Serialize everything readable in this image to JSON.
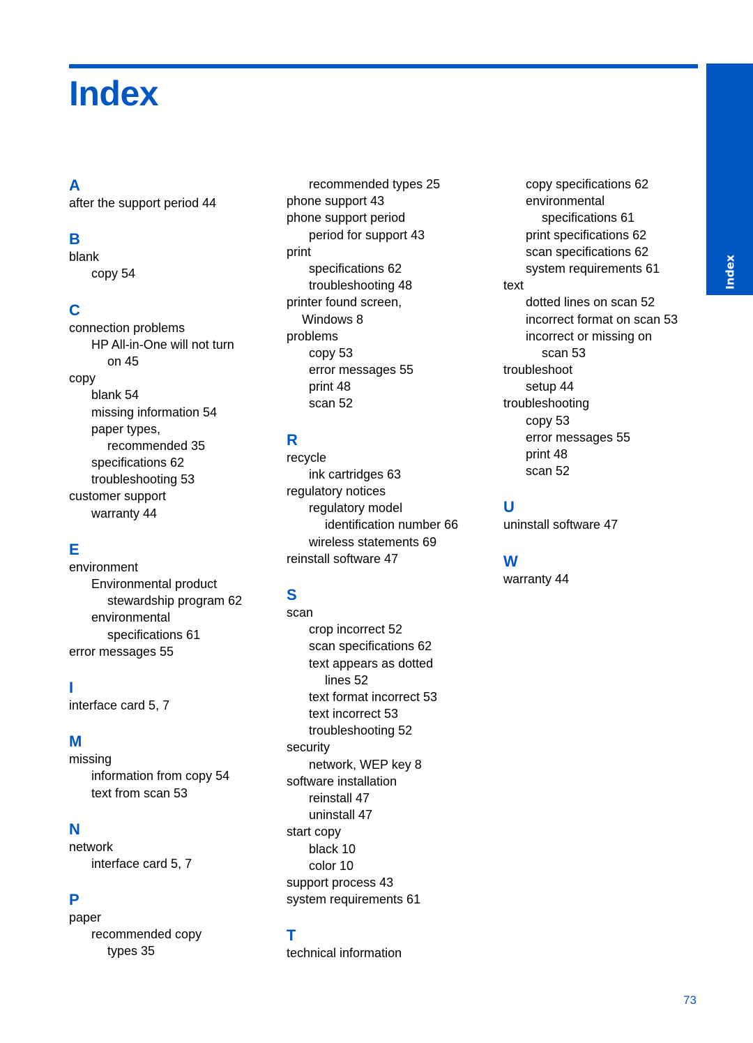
{
  "header": {
    "title": "Index",
    "side_tab": "Index",
    "accent_color": "#0057c2"
  },
  "footer": {
    "page_number": "73"
  },
  "columns": [
    {
      "blocks": [
        {
          "type": "letter",
          "text": "A"
        },
        {
          "type": "entry",
          "level": 0,
          "text": "after the support period 44"
        },
        {
          "type": "gap"
        },
        {
          "type": "letter",
          "text": "B"
        },
        {
          "type": "entry",
          "level": 0,
          "text": "blank"
        },
        {
          "type": "entry",
          "level": 1,
          "text": "copy 54"
        },
        {
          "type": "gap"
        },
        {
          "type": "letter",
          "text": "C"
        },
        {
          "type": "entry",
          "level": 0,
          "text": "connection problems"
        },
        {
          "type": "entry",
          "level": 1,
          "text": "HP All-in-One will not turn"
        },
        {
          "type": "entry",
          "level": 2,
          "text": "on 45"
        },
        {
          "type": "entry",
          "level": 0,
          "text": "copy"
        },
        {
          "type": "entry",
          "level": 1,
          "text": "blank 54"
        },
        {
          "type": "entry",
          "level": 1,
          "text": "missing information 54"
        },
        {
          "type": "entry",
          "level": 1,
          "text": "paper types,"
        },
        {
          "type": "entry",
          "level": 2,
          "text": "recommended 35"
        },
        {
          "type": "entry",
          "level": 1,
          "text": "specifications 62"
        },
        {
          "type": "entry",
          "level": 1,
          "text": "troubleshooting 53"
        },
        {
          "type": "entry",
          "level": 0,
          "text": "customer support"
        },
        {
          "type": "entry",
          "level": 1,
          "text": "warranty 44"
        },
        {
          "type": "gap"
        },
        {
          "type": "letter",
          "text": "E"
        },
        {
          "type": "entry",
          "level": 0,
          "text": "environment"
        },
        {
          "type": "entry",
          "level": 1,
          "text": "Environmental product"
        },
        {
          "type": "entry",
          "level": 2,
          "text": "stewardship program 62"
        },
        {
          "type": "entry",
          "level": 1,
          "text": "environmental"
        },
        {
          "type": "entry",
          "level": 2,
          "text": "specifications 61"
        },
        {
          "type": "entry",
          "level": 0,
          "text": "error messages 55"
        },
        {
          "type": "gap"
        },
        {
          "type": "letter",
          "text": "I"
        },
        {
          "type": "entry",
          "level": 0,
          "text": "interface card 5, 7"
        },
        {
          "type": "gap"
        },
        {
          "type": "letter",
          "text": "M"
        },
        {
          "type": "entry",
          "level": 0,
          "text": "missing"
        },
        {
          "type": "entry",
          "level": 1,
          "text": "information from copy 54"
        },
        {
          "type": "entry",
          "level": 1,
          "text": "text from scan 53"
        },
        {
          "type": "gap"
        },
        {
          "type": "letter",
          "text": "N"
        },
        {
          "type": "entry",
          "level": 0,
          "text": "network"
        },
        {
          "type": "entry",
          "level": 1,
          "text": "interface card 5, 7"
        },
        {
          "type": "gap"
        },
        {
          "type": "letter",
          "text": "P"
        },
        {
          "type": "entry",
          "level": 0,
          "text": "paper"
        },
        {
          "type": "entry",
          "level": 1,
          "text": "recommended copy"
        },
        {
          "type": "entry",
          "level": 2,
          "text": "types 35"
        }
      ]
    },
    {
      "blocks": [
        {
          "type": "entry",
          "level": 1,
          "text": "recommended types 25"
        },
        {
          "type": "entry",
          "level": 0,
          "text": "phone support 43"
        },
        {
          "type": "entry",
          "level": 0,
          "text": "phone support period"
        },
        {
          "type": "entry",
          "level": 1,
          "text": "period for support 43"
        },
        {
          "type": "entry",
          "level": 0,
          "text": "print"
        },
        {
          "type": "entry",
          "level": 1,
          "text": "specifications 62"
        },
        {
          "type": "entry",
          "level": 1,
          "text": "troubleshooting 48"
        },
        {
          "type": "entry",
          "level": 0,
          "text": "printer found screen,"
        },
        {
          "type": "entry",
          "level": "c",
          "text": "Windows 8"
        },
        {
          "type": "entry",
          "level": 0,
          "text": "problems"
        },
        {
          "type": "entry",
          "level": 1,
          "text": "copy 53"
        },
        {
          "type": "entry",
          "level": 1,
          "text": "error messages 55"
        },
        {
          "type": "entry",
          "level": 1,
          "text": "print 48"
        },
        {
          "type": "entry",
          "level": 1,
          "text": "scan 52"
        },
        {
          "type": "gap"
        },
        {
          "type": "letter",
          "text": "R"
        },
        {
          "type": "entry",
          "level": 0,
          "text": "recycle"
        },
        {
          "type": "entry",
          "level": 1,
          "text": "ink cartridges 63"
        },
        {
          "type": "entry",
          "level": 0,
          "text": "regulatory notices"
        },
        {
          "type": "entry",
          "level": 1,
          "text": "regulatory model"
        },
        {
          "type": "entry",
          "level": 2,
          "text": "identification number 66"
        },
        {
          "type": "entry",
          "level": 1,
          "text": "wireless statements 69"
        },
        {
          "type": "entry",
          "level": 0,
          "text": "reinstall software 47"
        },
        {
          "type": "gap"
        },
        {
          "type": "letter",
          "text": "S"
        },
        {
          "type": "entry",
          "level": 0,
          "text": "scan"
        },
        {
          "type": "entry",
          "level": 1,
          "text": "crop incorrect 52"
        },
        {
          "type": "entry",
          "level": 1,
          "text": "scan specifications 62"
        },
        {
          "type": "entry",
          "level": 1,
          "text": "text appears as dotted"
        },
        {
          "type": "entry",
          "level": 2,
          "text": "lines 52"
        },
        {
          "type": "entry",
          "level": 1,
          "text": "text format incorrect 53"
        },
        {
          "type": "entry",
          "level": 1,
          "text": "text incorrect 53"
        },
        {
          "type": "entry",
          "level": 1,
          "text": "troubleshooting 52"
        },
        {
          "type": "entry",
          "level": 0,
          "text": "security"
        },
        {
          "type": "entry",
          "level": 1,
          "text": "network, WEP key 8"
        },
        {
          "type": "entry",
          "level": 0,
          "text": "software installation"
        },
        {
          "type": "entry",
          "level": 1,
          "text": "reinstall 47"
        },
        {
          "type": "entry",
          "level": 1,
          "text": "uninstall 47"
        },
        {
          "type": "entry",
          "level": 0,
          "text": "start copy"
        },
        {
          "type": "entry",
          "level": 1,
          "text": "black 10"
        },
        {
          "type": "entry",
          "level": 1,
          "text": "color 10"
        },
        {
          "type": "entry",
          "level": 0,
          "text": "support process 43"
        },
        {
          "type": "entry",
          "level": 0,
          "text": "system requirements 61"
        },
        {
          "type": "gap"
        },
        {
          "type": "letter",
          "text": "T"
        },
        {
          "type": "entry",
          "level": 0,
          "text": "technical information"
        }
      ]
    },
    {
      "blocks": [
        {
          "type": "entry",
          "level": 1,
          "text": "copy specifications 62"
        },
        {
          "type": "entry",
          "level": 1,
          "text": "environmental"
        },
        {
          "type": "entry",
          "level": 2,
          "text": "specifications 61"
        },
        {
          "type": "entry",
          "level": 1,
          "text": "print specifications 62"
        },
        {
          "type": "entry",
          "level": 1,
          "text": "scan specifications 62"
        },
        {
          "type": "entry",
          "level": 1,
          "text": "system requirements 61"
        },
        {
          "type": "entry",
          "level": 0,
          "text": "text"
        },
        {
          "type": "entry",
          "level": 1,
          "text": "dotted lines on scan 52"
        },
        {
          "type": "entry",
          "level": 1,
          "text": "incorrect format on scan 53"
        },
        {
          "type": "entry",
          "level": 1,
          "text": "incorrect or missing on"
        },
        {
          "type": "entry",
          "level": 2,
          "text": "scan 53"
        },
        {
          "type": "entry",
          "level": 0,
          "text": "troubleshoot"
        },
        {
          "type": "entry",
          "level": 1,
          "text": "setup 44"
        },
        {
          "type": "entry",
          "level": 0,
          "text": "troubleshooting"
        },
        {
          "type": "entry",
          "level": 1,
          "text": "copy 53"
        },
        {
          "type": "entry",
          "level": 1,
          "text": "error messages 55"
        },
        {
          "type": "entry",
          "level": 1,
          "text": "print 48"
        },
        {
          "type": "entry",
          "level": 1,
          "text": "scan 52"
        },
        {
          "type": "gap"
        },
        {
          "type": "letter",
          "text": "U"
        },
        {
          "type": "entry",
          "level": 0,
          "text": "uninstall software 47"
        },
        {
          "type": "gap"
        },
        {
          "type": "letter",
          "text": "W"
        },
        {
          "type": "entry",
          "level": 0,
          "text": "warranty 44"
        }
      ]
    }
  ]
}
